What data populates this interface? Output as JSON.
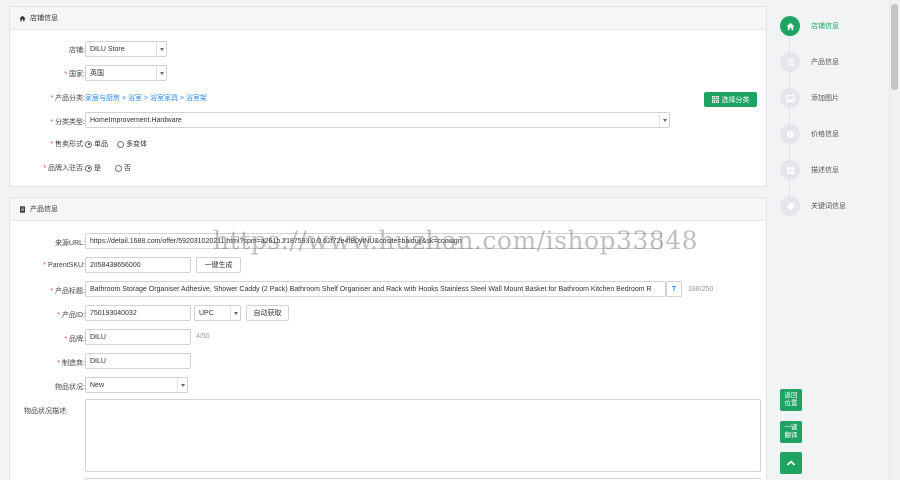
{
  "store_panel": {
    "title": "店铺信息",
    "store_label": "店铺:",
    "store_value": "DILU Store",
    "country_label": "国家:",
    "country_value": "英国",
    "category_label": "产品分类:",
    "category_path": "家居与厨房 > 浴室 > 浴室家具 > 浴室架",
    "choose_category_button": "选择分类",
    "category_type_label": "分类类型:",
    "category_type_value": "HomeImprovement.Hardware",
    "sale_form_label": "售卖形式:",
    "sale_form_options": [
      "单品",
      "多变体"
    ],
    "brand_label": "品牌入驻否:",
    "brand_options": [
      "是",
      "否"
    ]
  },
  "product_panel": {
    "title": "产品信息",
    "source_url_label": "来源URL:",
    "source_url_value": "https://detail.1688.com/offer/592031020211.html?spm=a261b.2187593.0.0.62f72e4fB0ytNU&cosite=baidujj&sk=consign",
    "parent_sku_label": "ParentSKU:",
    "parent_sku_value": "2II58438656000",
    "generate_button": "一键生成",
    "title_label": "产品标题:",
    "title_value": "Bathroom Storage Organiser Adhesive, Shower Caddy (2 Pack) Bathroom Shelf Organiser and Rack with Hooks Stainless Steel Wall Mount Basket for Bathroom Kitchen Bedroom R",
    "title_tool": "T",
    "title_count": "188/250",
    "product_id_label": "产品ID:",
    "product_id_value": "750193040032",
    "id_type_value": "UPC",
    "auto_fetch_button": "自动获取",
    "brand_label": "品牌:",
    "brand_value": "DILU",
    "brand_count": "4/50",
    "manufacturer_label": "制造商:",
    "manufacturer_value": "DILU",
    "condition_label": "物品状况:",
    "condition_value": "New",
    "condition_desc_label": "物品状况描述:"
  },
  "right_nav": {
    "items": [
      {
        "label": "店铺信息",
        "icon": "home-icon"
      },
      {
        "label": "产品信息",
        "icon": "list-icon"
      },
      {
        "label": "添加图片",
        "icon": "image-icon"
      },
      {
        "label": "价格信息",
        "icon": "info-icon"
      },
      {
        "label": "描述信息",
        "icon": "grid-icon"
      },
      {
        "label": "关键词信息",
        "icon": "tag-icon"
      }
    ],
    "back_button": "返回\n位置",
    "translate_button": "一键\n翻译"
  },
  "watermark": "https://www.huzhan.com/ishop33848",
  "colors": {
    "accent": "#1ea362",
    "link": "#2d8cf0",
    "required": "#e23c3c"
  }
}
